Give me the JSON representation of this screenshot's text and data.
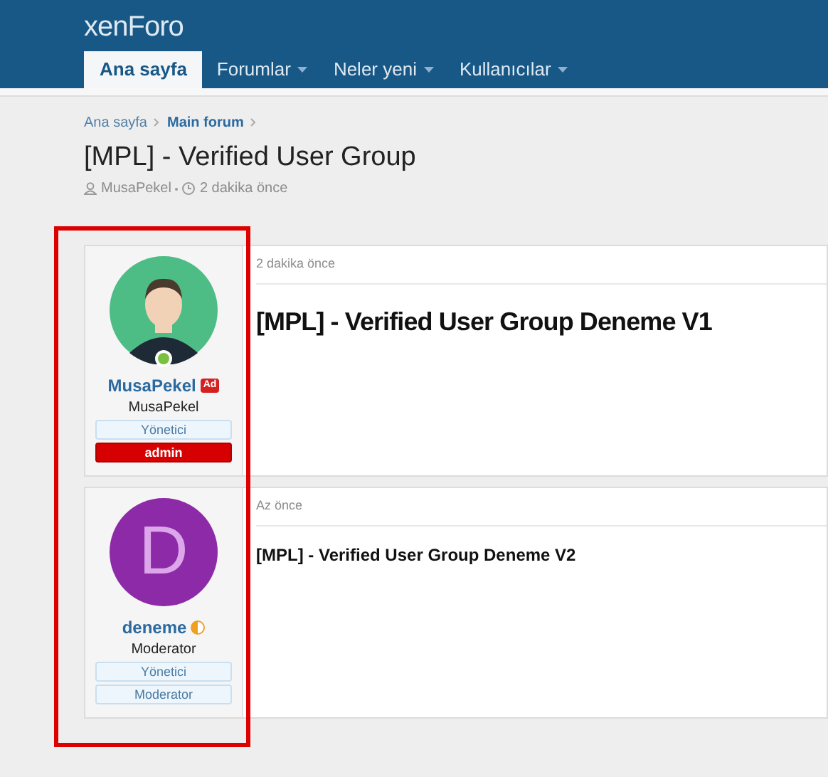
{
  "header": {
    "logo": "xenForo"
  },
  "nav": [
    {
      "label": "Ana sayfa",
      "selected": true,
      "has_menu": false
    },
    {
      "label": "Forumlar",
      "selected": false,
      "has_menu": true
    },
    {
      "label": "Neler yeni",
      "selected": false,
      "has_menu": true
    },
    {
      "label": "Kullanıcılar",
      "selected": false,
      "has_menu": true
    }
  ],
  "breadcrumb": [
    {
      "label": "Ana sayfa",
      "current": false
    },
    {
      "label": "Main forum",
      "current": true
    }
  ],
  "thread": {
    "title": "[MPL] - Verified User Group",
    "author": "MusaPekel",
    "time": "2 dakika önce"
  },
  "posts": [
    {
      "online": true,
      "username": "MusaPekel",
      "name_badge": {
        "kind": "text",
        "text": "Ad"
      },
      "user_title": "MusaPekel",
      "banners": [
        {
          "text": "Yönetici",
          "kind": "plain"
        },
        {
          "text": "admin",
          "kind": "red"
        }
      ],
      "time": "2 dakika önce",
      "message": "[MPL] - Verified User Group Deneme V1",
      "large": true
    },
    {
      "avatar": {
        "kind": "letter",
        "letter": "D",
        "color": "#8d2aa8"
      },
      "online": false,
      "username": "deneme",
      "name_badge": {
        "kind": "half-circle"
      },
      "user_title": "Moderator",
      "banners": [
        {
          "text": "Yönetici",
          "kind": "plain"
        },
        {
          "text": "Moderator",
          "kind": "plain"
        }
      ],
      "time": "Az önce",
      "message": "[MPL] - Verified User Group Deneme V2",
      "large": false
    }
  ],
  "highlight": {
    "shown": true
  }
}
